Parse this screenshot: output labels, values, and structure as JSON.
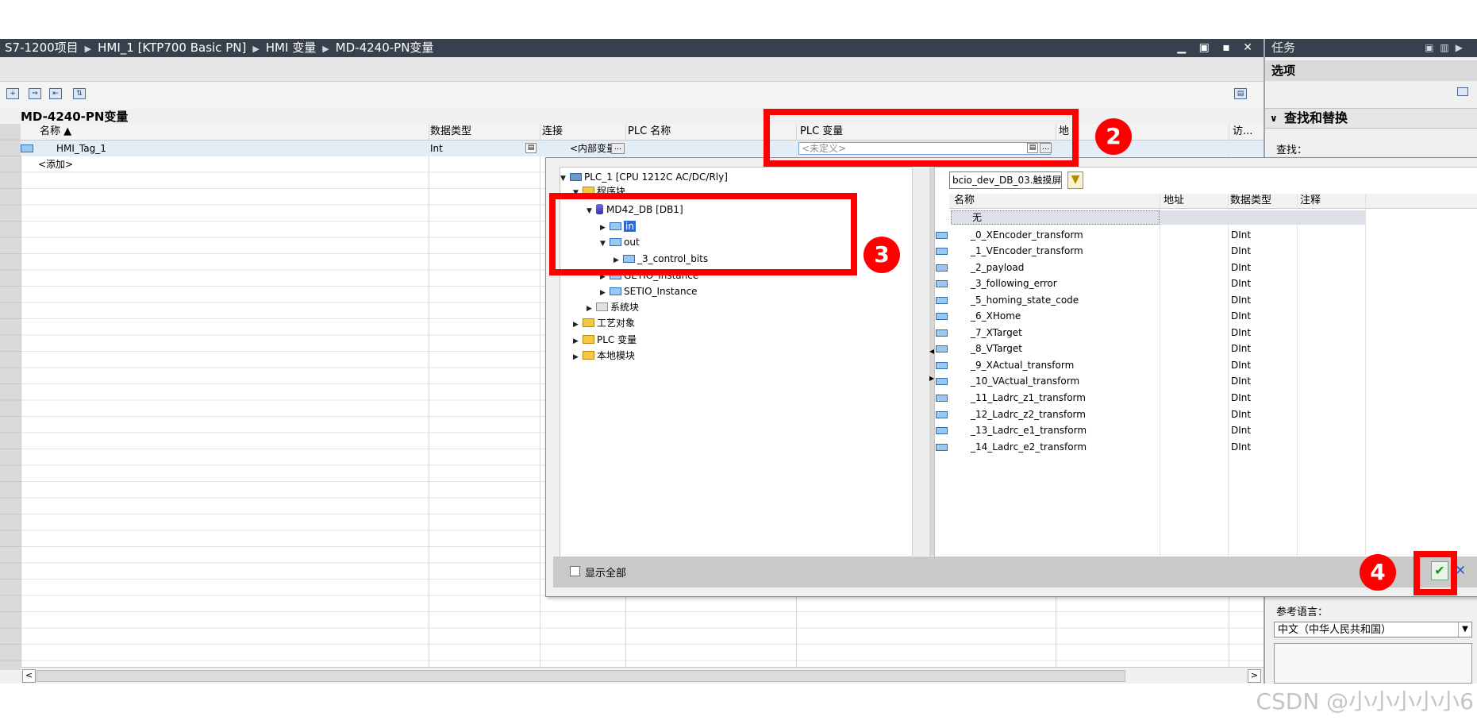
{
  "breadcrumb": [
    "S7-1200项目",
    "HMI_1 [KTP700 Basic PN]",
    "HMI 变量",
    "MD-4240-PN变量"
  ],
  "window_controls": "▁ ▣ ▪ ✕",
  "table": {
    "title": "MD-4240-PN变量",
    "columns": {
      "name": "名称 ▲",
      "datatype": "数据类型",
      "connection": "连接",
      "plc_name": "PLC 名称",
      "plc_var": "PLC 变量",
      "address": "地",
      "access": "访..."
    },
    "row": {
      "name": "HMI_Tag_1",
      "datatype": "Int",
      "connection": "<内部变量>",
      "plc_var_placeholder": "<未定义>"
    },
    "add_row": "<添加>"
  },
  "task_panel": {
    "title": "任务",
    "options": "选项",
    "section": "查找和替换",
    "find_label": "查找：",
    "ref_lang_label": "参考语言：",
    "ref_lang_value": "中文（中华人民共和国）"
  },
  "popup": {
    "tree": [
      {
        "label": "PLC_1 [CPU 1212C AC/DC/Rly]"
      },
      {
        "label": "程序块"
      },
      {
        "label": "MD42_DB [DB1]"
      },
      {
        "label": "in"
      },
      {
        "label": "out"
      },
      {
        "label": "_3_control_bits"
      },
      {
        "label": "GETIO_Instance"
      },
      {
        "label": "SETIO_Instance"
      },
      {
        "label": "系统块"
      },
      {
        "label": "工艺对象"
      },
      {
        "label": "PLC 变量"
      },
      {
        "label": "本地模块"
      }
    ],
    "search_value": "bcio_dev_DB_03.触摸屏",
    "list_columns": {
      "name": "名称",
      "address": "地址",
      "datatype": "数据类型",
      "comment": "注释"
    },
    "none_label": "无",
    "items": [
      {
        "name": "_0_XEncoder_transform",
        "type": "DInt"
      },
      {
        "name": "_1_VEncoder_transform",
        "type": "DInt"
      },
      {
        "name": "_2_payload",
        "type": "DInt"
      },
      {
        "name": "_3_following_error",
        "type": "DInt"
      },
      {
        "name": "_5_homing_state_code",
        "type": "DInt"
      },
      {
        "name": "_6_XHome",
        "type": "DInt"
      },
      {
        "name": "_7_XTarget",
        "type": "DInt"
      },
      {
        "name": "_8_VTarget",
        "type": "DInt"
      },
      {
        "name": "_9_XActual_transform",
        "type": "DInt"
      },
      {
        "name": "_10_VActual_transform",
        "type": "DInt"
      },
      {
        "name": "_11_Ladrc_z1_transform",
        "type": "DInt"
      },
      {
        "name": "_12_Ladrc_z2_transform",
        "type": "DInt"
      },
      {
        "name": "_13_Ladrc_e1_transform",
        "type": "DInt"
      },
      {
        "name": "_14_Ladrc_e2_transform",
        "type": "DInt"
      }
    ],
    "show_all": "显示全部"
  },
  "annotations": {
    "step2": "2",
    "step3": "3",
    "step4": "4",
    "color": "#ff0000"
  },
  "watermark": "CSDN @小小小小小6"
}
